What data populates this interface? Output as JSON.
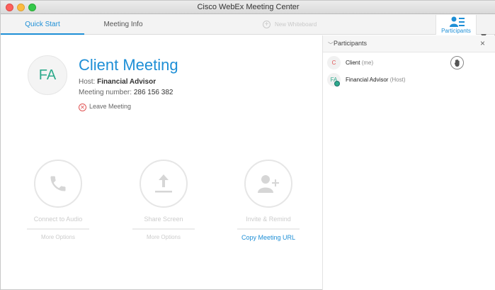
{
  "window": {
    "title": "Cisco WebEx Meeting Center"
  },
  "tabs": {
    "quick_start": "Quick Start",
    "meeting_info": "Meeting Info",
    "new_whiteboard": "New Whiteboard",
    "participants": "Participants"
  },
  "meeting": {
    "initials": "FA",
    "title": "Client Meeting",
    "host_label": "Host:",
    "host_name": "Financial Advisor",
    "number_label": "Meeting number:",
    "number": "286 156 382",
    "leave": "Leave Meeting"
  },
  "actions": [
    {
      "label": "Connect to Audio",
      "sub": "More Options",
      "icon": "phone-icon"
    },
    {
      "label": "Share Screen",
      "sub": "More Options",
      "icon": "upload-icon"
    },
    {
      "label": "Invite & Remind",
      "sub": "Copy Meeting URL",
      "icon": "add-person-icon"
    }
  ],
  "participants_panel": {
    "title": "Participants",
    "close": "×",
    "list": [
      {
        "initials": "C",
        "name": "Client",
        "role": "(me)"
      },
      {
        "initials": "FA",
        "name": "Financial Advisor",
        "role": "(Host)"
      }
    ]
  },
  "colors": {
    "accent": "#1e8fd6",
    "avatar_green": "#2eaa8c",
    "leave_red": "#e05353"
  }
}
